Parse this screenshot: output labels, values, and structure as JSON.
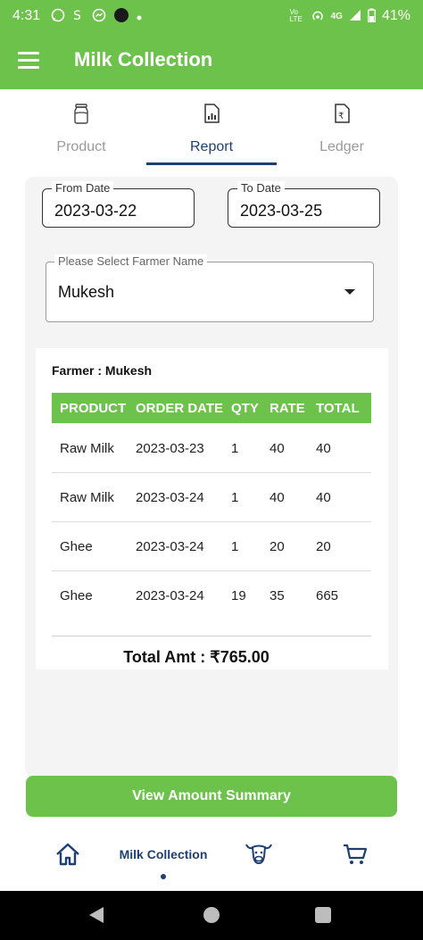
{
  "status_bar": {
    "time": "4:31",
    "carrier_badge": "Vo LTE",
    "network": "4G",
    "battery": "41%"
  },
  "app_bar": {
    "title": "Milk Collection"
  },
  "tabs": [
    {
      "label": "Product",
      "icon": "milk-can-icon",
      "active": false
    },
    {
      "label": "Report",
      "icon": "report-icon",
      "active": true
    },
    {
      "label": "Ledger",
      "icon": "ledger-icon",
      "active": false
    }
  ],
  "filters": {
    "from_date_label": "From Date",
    "from_date_value": "2023-03-22",
    "to_date_label": "To Date",
    "to_date_value": "2023-03-25",
    "farmer_label": "Please Select Farmer Name",
    "farmer_value": "Mukesh"
  },
  "report": {
    "farmer_heading": "Farmer : Mukesh",
    "columns": [
      "PRODUCT",
      "ORDER DATE",
      "QTY",
      "RATE",
      "TOTAL"
    ],
    "rows": [
      {
        "product": "Raw Milk",
        "order_date": "2023-03-23",
        "qty": "1",
        "rate": "40",
        "total": "40"
      },
      {
        "product": "Raw Milk",
        "order_date": "2023-03-24",
        "qty": "1",
        "rate": "40",
        "total": "40"
      },
      {
        "product": "Ghee",
        "order_date": "2023-03-24",
        "qty": "1",
        "rate": "20",
        "total": "20"
      },
      {
        "product": "Ghee",
        "order_date": "2023-03-24",
        "qty": "19",
        "rate": "35",
        "total": "665"
      }
    ],
    "total_amount": "Total Amt : ₹765.00"
  },
  "summary_button_label": "View Amount Summary",
  "bottom_nav": {
    "active_label": "Milk Collection",
    "items": [
      "home-icon",
      "milk-collection",
      "cow-icon",
      "cart-icon"
    ]
  },
  "colors": {
    "brand_green": "#6cc24a",
    "accent_navy": "#1e3f74"
  }
}
